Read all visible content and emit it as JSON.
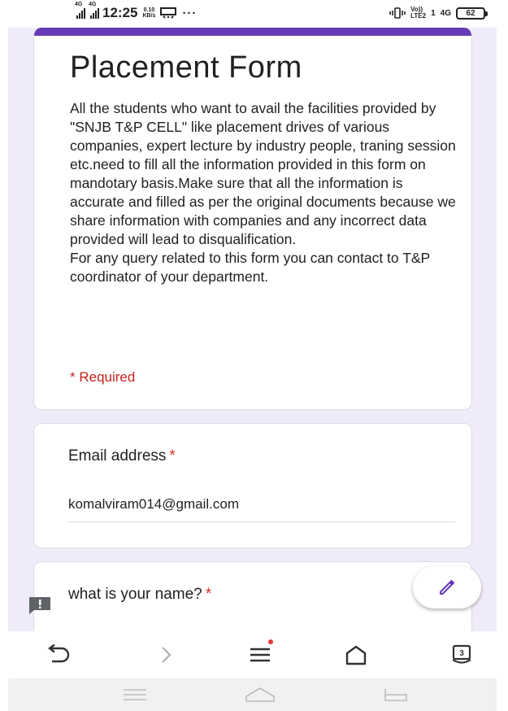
{
  "status_bar": {
    "network_1": "4G",
    "network_2": "4G",
    "time": "12:25",
    "speed_value": "0.10",
    "speed_unit": "KB/s",
    "more": "···",
    "volte": "Vo))",
    "lte": "LTE2",
    "sim": "1",
    "network_3": "4G",
    "battery": "62"
  },
  "form": {
    "accent_color": "#673ab7",
    "title": "Placement Form",
    "description": "All the students who want to avail the facilities provided by \"SNJB T&P CELL\" like placement drives of various companies, expert lecture by industry people, traning session etc.need to fill all the information provided in this form on mandotary basis.Make sure that all the information is accurate and filled as per the original documents because we share information with companies and any incorrect data provided will lead to disqualification.\nFor any query related to this form you can contact to T&P coordinator of your department.",
    "required_note": "* Required"
  },
  "questions": [
    {
      "title": "Email address",
      "required_mark": "*",
      "value": "komalviram014@gmail.com"
    },
    {
      "title": "what is your name?",
      "required_mark": "*"
    }
  ],
  "icons": {
    "fab": "pencil-icon",
    "feedback": "feedback-icon",
    "back": "back-arrow-icon",
    "forward": "forward-arrow-icon",
    "menu": "menu-icon",
    "home": "home-icon",
    "tabs": "tabs-icon"
  },
  "browser_nav": {
    "tabs_count": "3"
  }
}
